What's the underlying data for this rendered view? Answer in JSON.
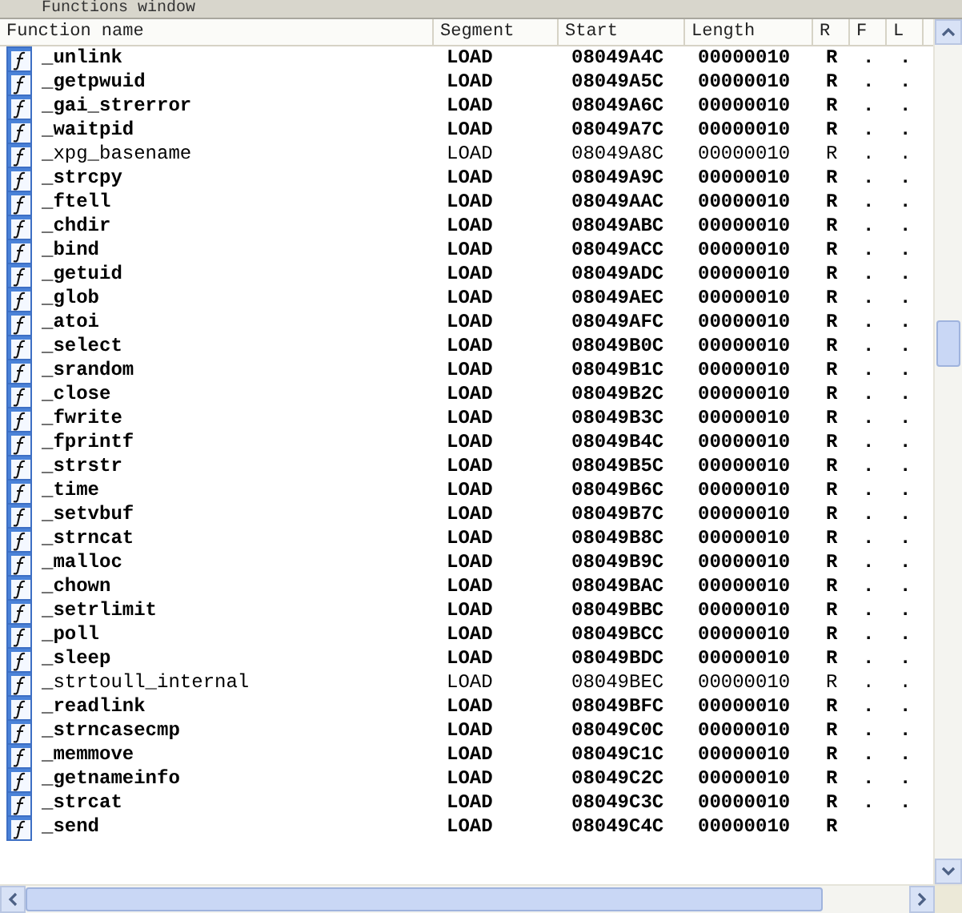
{
  "window": {
    "title": "Functions window"
  },
  "table": {
    "columns": [
      "Function name",
      "Segment",
      "Start",
      "Length",
      "R",
      "F",
      "L"
    ],
    "rows": [
      {
        "name": "_unlink",
        "segment": "LOAD",
        "start": "08049A4C",
        "length": "00000010",
        "r": "R",
        "f": ".",
        "l": ".",
        "bold": true
      },
      {
        "name": "_getpwuid",
        "segment": "LOAD",
        "start": "08049A5C",
        "length": "00000010",
        "r": "R",
        "f": ".",
        "l": ".",
        "bold": true
      },
      {
        "name": "_gai_strerror",
        "segment": "LOAD",
        "start": "08049A6C",
        "length": "00000010",
        "r": "R",
        "f": ".",
        "l": ".",
        "bold": true
      },
      {
        "name": "_waitpid",
        "segment": "LOAD",
        "start": "08049A7C",
        "length": "00000010",
        "r": "R",
        "f": ".",
        "l": ".",
        "bold": true
      },
      {
        "name": "_xpg_basename",
        "segment": "LOAD",
        "start": "08049A8C",
        "length": "00000010",
        "r": "R",
        "f": ".",
        "l": ".",
        "bold": false
      },
      {
        "name": "_strcpy",
        "segment": "LOAD",
        "start": "08049A9C",
        "length": "00000010",
        "r": "R",
        "f": ".",
        "l": ".",
        "bold": true
      },
      {
        "name": "_ftell",
        "segment": "LOAD",
        "start": "08049AAC",
        "length": "00000010",
        "r": "R",
        "f": ".",
        "l": ".",
        "bold": true
      },
      {
        "name": "_chdir",
        "segment": "LOAD",
        "start": "08049ABC",
        "length": "00000010",
        "r": "R",
        "f": ".",
        "l": ".",
        "bold": true
      },
      {
        "name": "_bind",
        "segment": "LOAD",
        "start": "08049ACC",
        "length": "00000010",
        "r": "R",
        "f": ".",
        "l": ".",
        "bold": true
      },
      {
        "name": "_getuid",
        "segment": "LOAD",
        "start": "08049ADC",
        "length": "00000010",
        "r": "R",
        "f": ".",
        "l": ".",
        "bold": true
      },
      {
        "name": "_glob",
        "segment": "LOAD",
        "start": "08049AEC",
        "length": "00000010",
        "r": "R",
        "f": ".",
        "l": ".",
        "bold": true
      },
      {
        "name": "_atoi",
        "segment": "LOAD",
        "start": "08049AFC",
        "length": "00000010",
        "r": "R",
        "f": ".",
        "l": ".",
        "bold": true
      },
      {
        "name": "_select",
        "segment": "LOAD",
        "start": "08049B0C",
        "length": "00000010",
        "r": "R",
        "f": ".",
        "l": ".",
        "bold": true
      },
      {
        "name": "_srandom",
        "segment": "LOAD",
        "start": "08049B1C",
        "length": "00000010",
        "r": "R",
        "f": ".",
        "l": ".",
        "bold": true
      },
      {
        "name": "_close",
        "segment": "LOAD",
        "start": "08049B2C",
        "length": "00000010",
        "r": "R",
        "f": ".",
        "l": ".",
        "bold": true
      },
      {
        "name": "_fwrite",
        "segment": "LOAD",
        "start": "08049B3C",
        "length": "00000010",
        "r": "R",
        "f": ".",
        "l": ".",
        "bold": true
      },
      {
        "name": "_fprintf",
        "segment": "LOAD",
        "start": "08049B4C",
        "length": "00000010",
        "r": "R",
        "f": ".",
        "l": ".",
        "bold": true
      },
      {
        "name": "_strstr",
        "segment": "LOAD",
        "start": "08049B5C",
        "length": "00000010",
        "r": "R",
        "f": ".",
        "l": ".",
        "bold": true
      },
      {
        "name": "_time",
        "segment": "LOAD",
        "start": "08049B6C",
        "length": "00000010",
        "r": "R",
        "f": ".",
        "l": ".",
        "bold": true
      },
      {
        "name": "_setvbuf",
        "segment": "LOAD",
        "start": "08049B7C",
        "length": "00000010",
        "r": "R",
        "f": ".",
        "l": ".",
        "bold": true
      },
      {
        "name": "_strncat",
        "segment": "LOAD",
        "start": "08049B8C",
        "length": "00000010",
        "r": "R",
        "f": ".",
        "l": ".",
        "bold": true
      },
      {
        "name": "_malloc",
        "segment": "LOAD",
        "start": "08049B9C",
        "length": "00000010",
        "r": "R",
        "f": ".",
        "l": ".",
        "bold": true
      },
      {
        "name": "_chown",
        "segment": "LOAD",
        "start": "08049BAC",
        "length": "00000010",
        "r": "R",
        "f": ".",
        "l": ".",
        "bold": true
      },
      {
        "name": "_setrlimit",
        "segment": "LOAD",
        "start": "08049BBC",
        "length": "00000010",
        "r": "R",
        "f": ".",
        "l": ".",
        "bold": true
      },
      {
        "name": "_poll",
        "segment": "LOAD",
        "start": "08049BCC",
        "length": "00000010",
        "r": "R",
        "f": ".",
        "l": ".",
        "bold": true
      },
      {
        "name": "_sleep",
        "segment": "LOAD",
        "start": "08049BDC",
        "length": "00000010",
        "r": "R",
        "f": ".",
        "l": ".",
        "bold": true
      },
      {
        "name": "_strtoull_internal",
        "segment": "LOAD",
        "start": "08049BEC",
        "length": "00000010",
        "r": "R",
        "f": ".",
        "l": ".",
        "bold": false
      },
      {
        "name": "_readlink",
        "segment": "LOAD",
        "start": "08049BFC",
        "length": "00000010",
        "r": "R",
        "f": ".",
        "l": ".",
        "bold": true
      },
      {
        "name": "_strncasecmp",
        "segment": "LOAD",
        "start": "08049C0C",
        "length": "00000010",
        "r": "R",
        "f": ".",
        "l": ".",
        "bold": true
      },
      {
        "name": "_memmove",
        "segment": "LOAD",
        "start": "08049C1C",
        "length": "00000010",
        "r": "R",
        "f": ".",
        "l": ".",
        "bold": true
      },
      {
        "name": "_getnameinfo",
        "segment": "LOAD",
        "start": "08049C2C",
        "length": "00000010",
        "r": "R",
        "f": ".",
        "l": ".",
        "bold": true
      },
      {
        "name": "_strcat",
        "segment": "LOAD",
        "start": "08049C3C",
        "length": "00000010",
        "r": "R",
        "f": ".",
        "l": ".",
        "bold": true
      },
      {
        "name": "_send",
        "segment": "LOAD",
        "start": "08049C4C",
        "length": "00000010",
        "r": "R",
        "bold": true
      }
    ]
  }
}
